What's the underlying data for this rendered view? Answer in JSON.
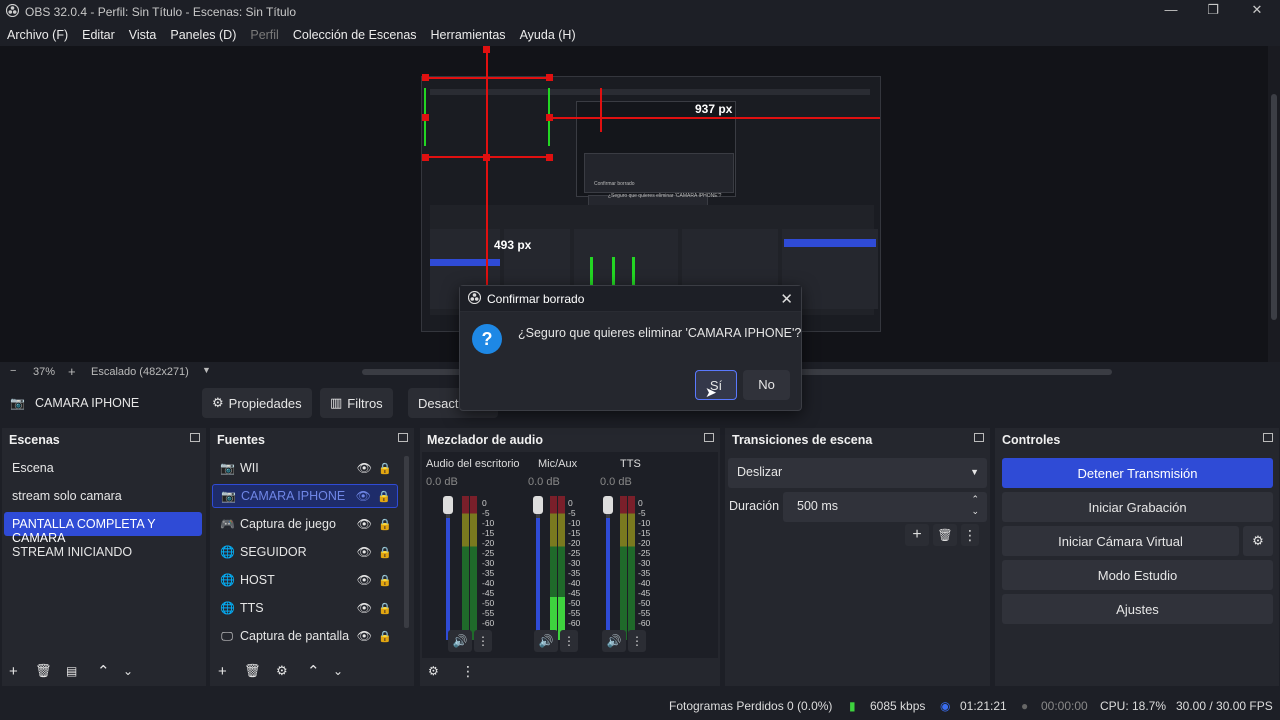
{
  "window": {
    "title": "OBS 32.0.4 - Perfil: Sin Título - Escenas: Sin Título",
    "minimize": "—",
    "maximize": "❐",
    "close": "✕"
  },
  "menu": [
    "Archivo (F)",
    "Editar",
    "Vista",
    "Paneles (D)",
    "Perfil",
    "Colección de Escenas",
    "Herramientas",
    "Ayuda (H)"
  ],
  "preview": {
    "measure_top": "937 px",
    "measure_left": "493 px",
    "mini_dialog_title": "Confirmar borrado",
    "mini_dialog_msg": "¿Seguro que quieres eliminar 'CAMARA IPHONE'?"
  },
  "zoom": {
    "minus": "−",
    "level": "37%",
    "plus": "+",
    "scaling": "Escalado (482x271)"
  },
  "context_bar": {
    "source_name": "CAMARA IPHONE",
    "properties": "Propiedades",
    "filters": "Filtros",
    "deactivate": "Desact"
  },
  "scenes": {
    "title": "Escenas",
    "items": [
      {
        "label": "Escena",
        "active": false
      },
      {
        "label": "stream solo camara",
        "active": false
      },
      {
        "label": "PANTALLA COMPLETA Y CAMARA",
        "active": true
      },
      {
        "label": "STREAM INICIANDO",
        "active": false
      }
    ]
  },
  "sources": {
    "title": "Fuentes",
    "items": [
      {
        "label": "WII",
        "icon": "camera-icon"
      },
      {
        "label": "CAMARA IPHONE",
        "icon": "camera-icon",
        "active": true
      },
      {
        "label": "Captura de juego",
        "icon": "gamepad-icon"
      },
      {
        "label": "SEGUIDOR",
        "icon": "globe-icon"
      },
      {
        "label": "HOST",
        "icon": "globe-icon"
      },
      {
        "label": "TTS",
        "icon": "globe-icon"
      },
      {
        "label": "Captura de pantalla",
        "icon": "monitor-icon"
      }
    ]
  },
  "mixer": {
    "title": "Mezclador de audio",
    "channels": [
      {
        "name": "Audio del escritorio",
        "db": "0.0 dB",
        "level": 0.55
      },
      {
        "name": "Mic/Aux",
        "db": "0.0 dB",
        "level": 0.75
      },
      {
        "name": "TTS",
        "db": "0.0 dB",
        "level": 0.5
      }
    ],
    "scale": [
      "0",
      "-5",
      "-10",
      "-15",
      "-20",
      "-25",
      "-30",
      "-35",
      "-40",
      "-45",
      "-50",
      "-55",
      "-60"
    ]
  },
  "transitions": {
    "title": "Transiciones de escena",
    "selected": "Deslizar",
    "duration_label": "Duración",
    "duration_value": "500 ms"
  },
  "controls": {
    "title": "Controles",
    "stop_stream": "Detener Transmisión",
    "start_recording": "Iniciar Grabación",
    "start_virtual_cam": "Iniciar Cámara Virtual",
    "studio_mode": "Modo Estudio",
    "settings": "Ajustes"
  },
  "status": {
    "dropped_frames": "Fotogramas Perdidos 0 (0.0%)",
    "bitrate": "6085 kbps",
    "stream_time": "01:21:21",
    "record_time": "00:00:00",
    "cpu": "CPU: 18.7%",
    "fps": "30.00 / 30.00 FPS"
  },
  "dialog": {
    "title": "Confirmar borrado",
    "message": "¿Seguro que quieres eliminar 'CAMARA IPHONE'?",
    "yes": "Sí",
    "no": "No"
  },
  "colors": {
    "accent": "#2f4bd6",
    "background": "#1d1f26",
    "panel": "#25272e",
    "guide_red": "#e01010",
    "guide_green": "#23d623"
  }
}
